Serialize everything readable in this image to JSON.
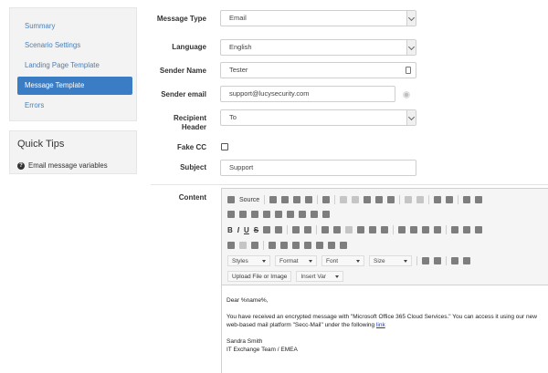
{
  "sidebar": {
    "items": [
      {
        "label": "Summary",
        "active": false
      },
      {
        "label": "Scenario Settings",
        "active": false
      },
      {
        "label": "Landing Page Template",
        "active": false
      },
      {
        "label": "Message Template",
        "active": true
      },
      {
        "label": "Errors",
        "active": false
      }
    ]
  },
  "quick_tips": {
    "title": "Quick Tips",
    "item": "Email message variables"
  },
  "form": {
    "message_type": {
      "label": "Message Type",
      "value": "Email"
    },
    "language": {
      "label": "Language",
      "value": "English"
    },
    "sender_name": {
      "label": "Sender Name",
      "value": "Tester"
    },
    "sender_email": {
      "label": "Sender email",
      "value": "support@lucysecurity.com"
    },
    "recipient_header": {
      "label_line1": "Recipient",
      "label_line2": "Header",
      "value": "To"
    },
    "fake_cc": {
      "label": "Fake CC",
      "checked": false
    },
    "subject": {
      "label": "Subject",
      "value": "Support"
    },
    "content": {
      "label": "Content"
    }
  },
  "editor": {
    "source_label": "Source",
    "dropdowns": [
      "Styles",
      "Format",
      "Font",
      "Size"
    ],
    "upload_label": "Upload File or Image",
    "insert_var_label": "Insert Var",
    "body": {
      "greeting": "Dear %name%,",
      "line1": "You have received an encrypted message with \"Microsoft Office 365 Cloud Services.\" You can access it using our new web-based mail platform \"Secc-Mail\" under the following",
      "link_text": "link",
      "signature_name": "Sandra Smith",
      "signature_team": "IT Exchange Team / EMEA"
    }
  }
}
